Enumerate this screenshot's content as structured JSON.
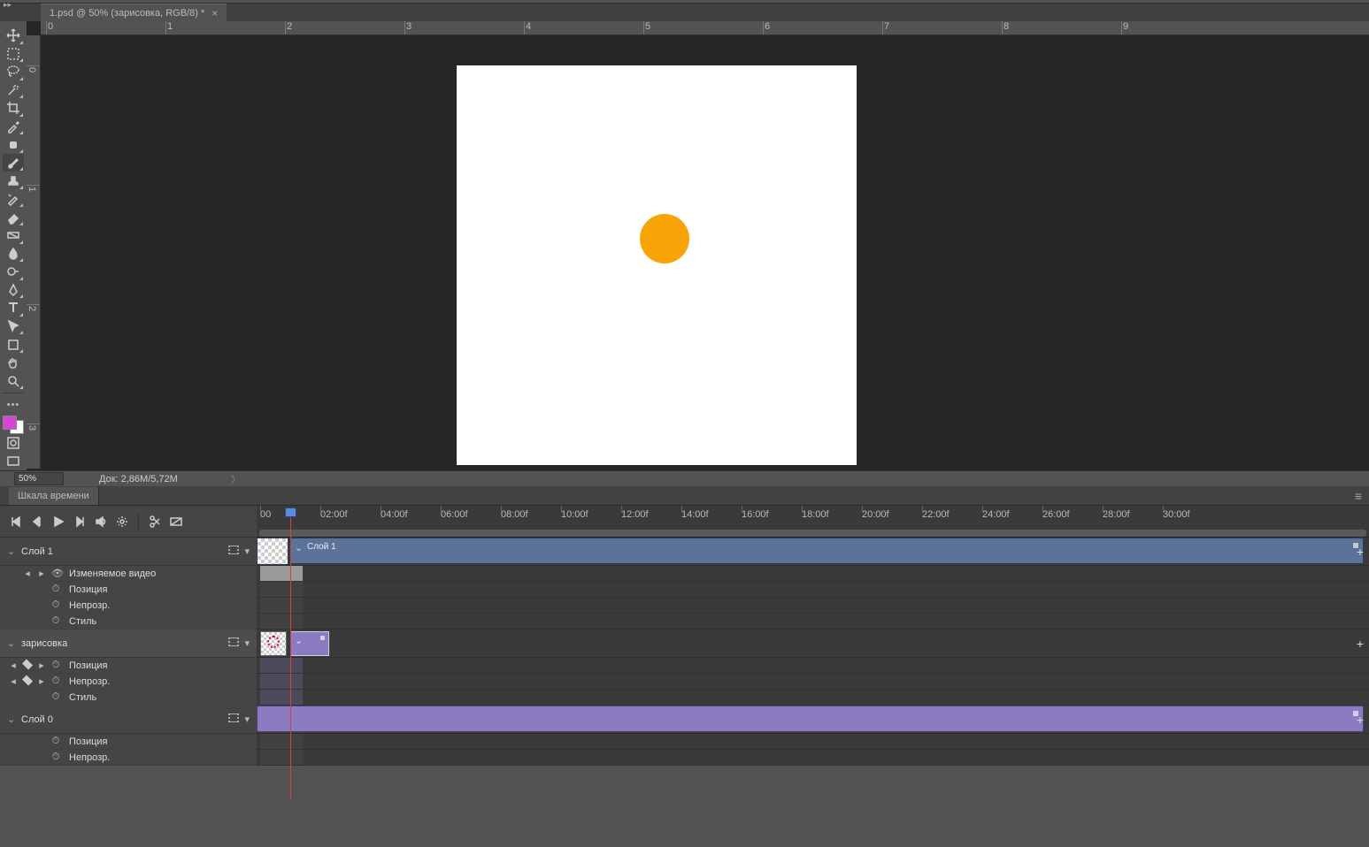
{
  "document": {
    "tab_title": "1.psd @ 50% (зарисовка, RGB/8) *"
  },
  "status": {
    "zoom": "50%",
    "docinfo": "Док: 2,86M/5,72M"
  },
  "ruler_h": [
    "0",
    "1",
    "2",
    "3",
    "4",
    "5",
    "6",
    "7",
    "8",
    "9"
  ],
  "ruler_v": [
    "0",
    "1",
    "2",
    "3"
  ],
  "panels": {
    "timeline_title": "Шкала времени"
  },
  "playback": {},
  "time_ticks": [
    "00",
    "02:00f",
    "04:00f",
    "06:00f",
    "08:00f",
    "10:00f",
    "12:00f",
    "14:00f",
    "16:00f",
    "18:00f",
    "20:00f",
    "22:00f",
    "24:00f",
    "26:00f",
    "28:00f",
    "30:00f"
  ],
  "tracks": {
    "layer1": {
      "name": "Слой 1",
      "clip_label": "Слой 1",
      "props": {
        "video": "Изменяемое видео",
        "position": "Позиция",
        "opacity": "Непрозр.",
        "style": "Стиль"
      }
    },
    "sketch": {
      "name": "зарисовка",
      "props": {
        "position": "Позиция",
        "opacity": "Непрозр.",
        "style": "Стиль"
      }
    },
    "layer0": {
      "name": "Слой 0",
      "props": {
        "position": "Позиция",
        "opacity": "Непрозр."
      }
    }
  }
}
